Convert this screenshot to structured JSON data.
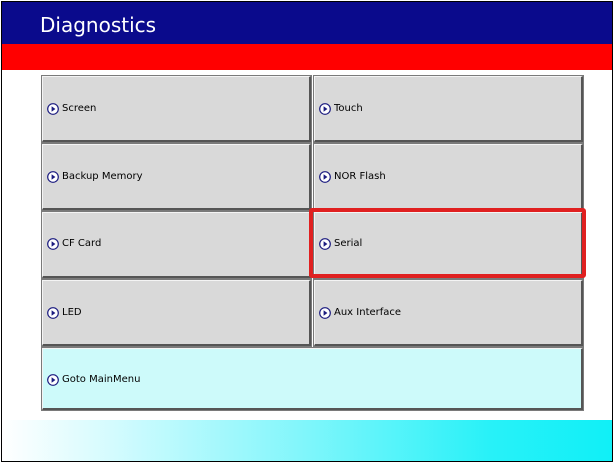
{
  "window": {
    "title": "Diagnostics"
  },
  "buttons": {
    "screen": "Screen",
    "touch": "Touch",
    "backup_memory": "Backup Memory",
    "nor_flash": "NOR Flash",
    "cf_card": "CF Card",
    "serial": "Serial",
    "led": "LED",
    "aux_interface": "Aux Interface",
    "goto_mainmenu": "Goto MainMenu"
  },
  "colors": {
    "title_bar": "#0a0a8c",
    "accent_band": "#ff0000",
    "button_face": "#d9d9d9",
    "main_menu_button": "#cdfafa",
    "highlight": "#e02020"
  },
  "icons": {
    "button_icon": "right-arrow-circle-icon"
  },
  "selected_item": "Serial"
}
